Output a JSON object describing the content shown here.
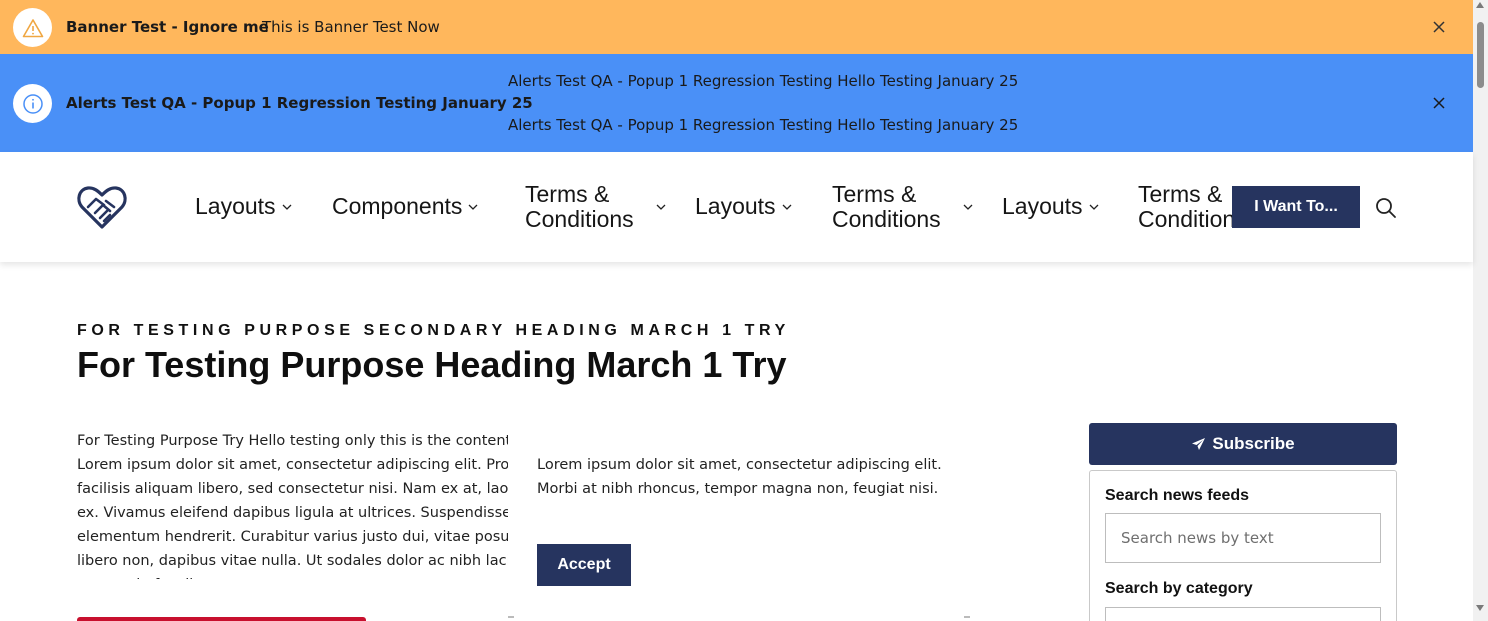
{
  "banners": {
    "warning": {
      "title": "Banner Test - Ignore me",
      "text": "This is Banner Test Now",
      "color": "#ffb75c"
    },
    "alert": {
      "title": "Alerts Test QA - Popup 1 Regression Testing  January 25",
      "line1": "Alerts Test QA - Popup 1 Regression Testing Hello Testing January 25",
      "line2": "Alerts Test QA - Popup 1 Regression Testing Hello Testing January 25",
      "color": "#4a90f7"
    }
  },
  "header": {
    "nav": [
      {
        "label": "Layouts"
      },
      {
        "label": "Components"
      },
      {
        "label": "Terms & Conditions"
      },
      {
        "label": "Layouts"
      },
      {
        "label": "Terms & Conditions"
      },
      {
        "label": "Layouts"
      },
      {
        "label": "Terms & Conditions"
      }
    ],
    "cta_label": "I Want To..."
  },
  "main": {
    "eyebrow": "FOR TESTING PURPOSE SECONDARY HEADING MARCH 1 TRY",
    "title": "For Testing Purpose Heading March 1 Try",
    "body": "For Testing Purpose Try Hello testing only this is the content. Lorem ipsum dolor sit amet, consectetur adipiscing elit. Proin facilisis aliquam libero, sed consectetur nisi. Nam ex at, laoreet ex. Vivamus eleifend dapibus ligula at ultrices. Suspendisse elementum hendrerit. Curabitur varius justo dui, vitae posuere libero non, dapibus vitae nulla. Ut sodales dolor ac nibh lacinia tempus in faucibus."
  },
  "popup": {
    "text": "Lorem ipsum dolor sit amet, consectetur adipiscing elit. Morbi at nibh rhoncus, tempor magna non, feugiat nisi.",
    "accept_label": "Accept"
  },
  "sidebar": {
    "subscribe_label": "Subscribe",
    "search_news_label": "Search news feeds",
    "search_news_placeholder": "Search news by text",
    "category_label": "Search by category"
  },
  "colors": {
    "brand_navy": "#26345f",
    "accent_red": "#c8102e"
  }
}
